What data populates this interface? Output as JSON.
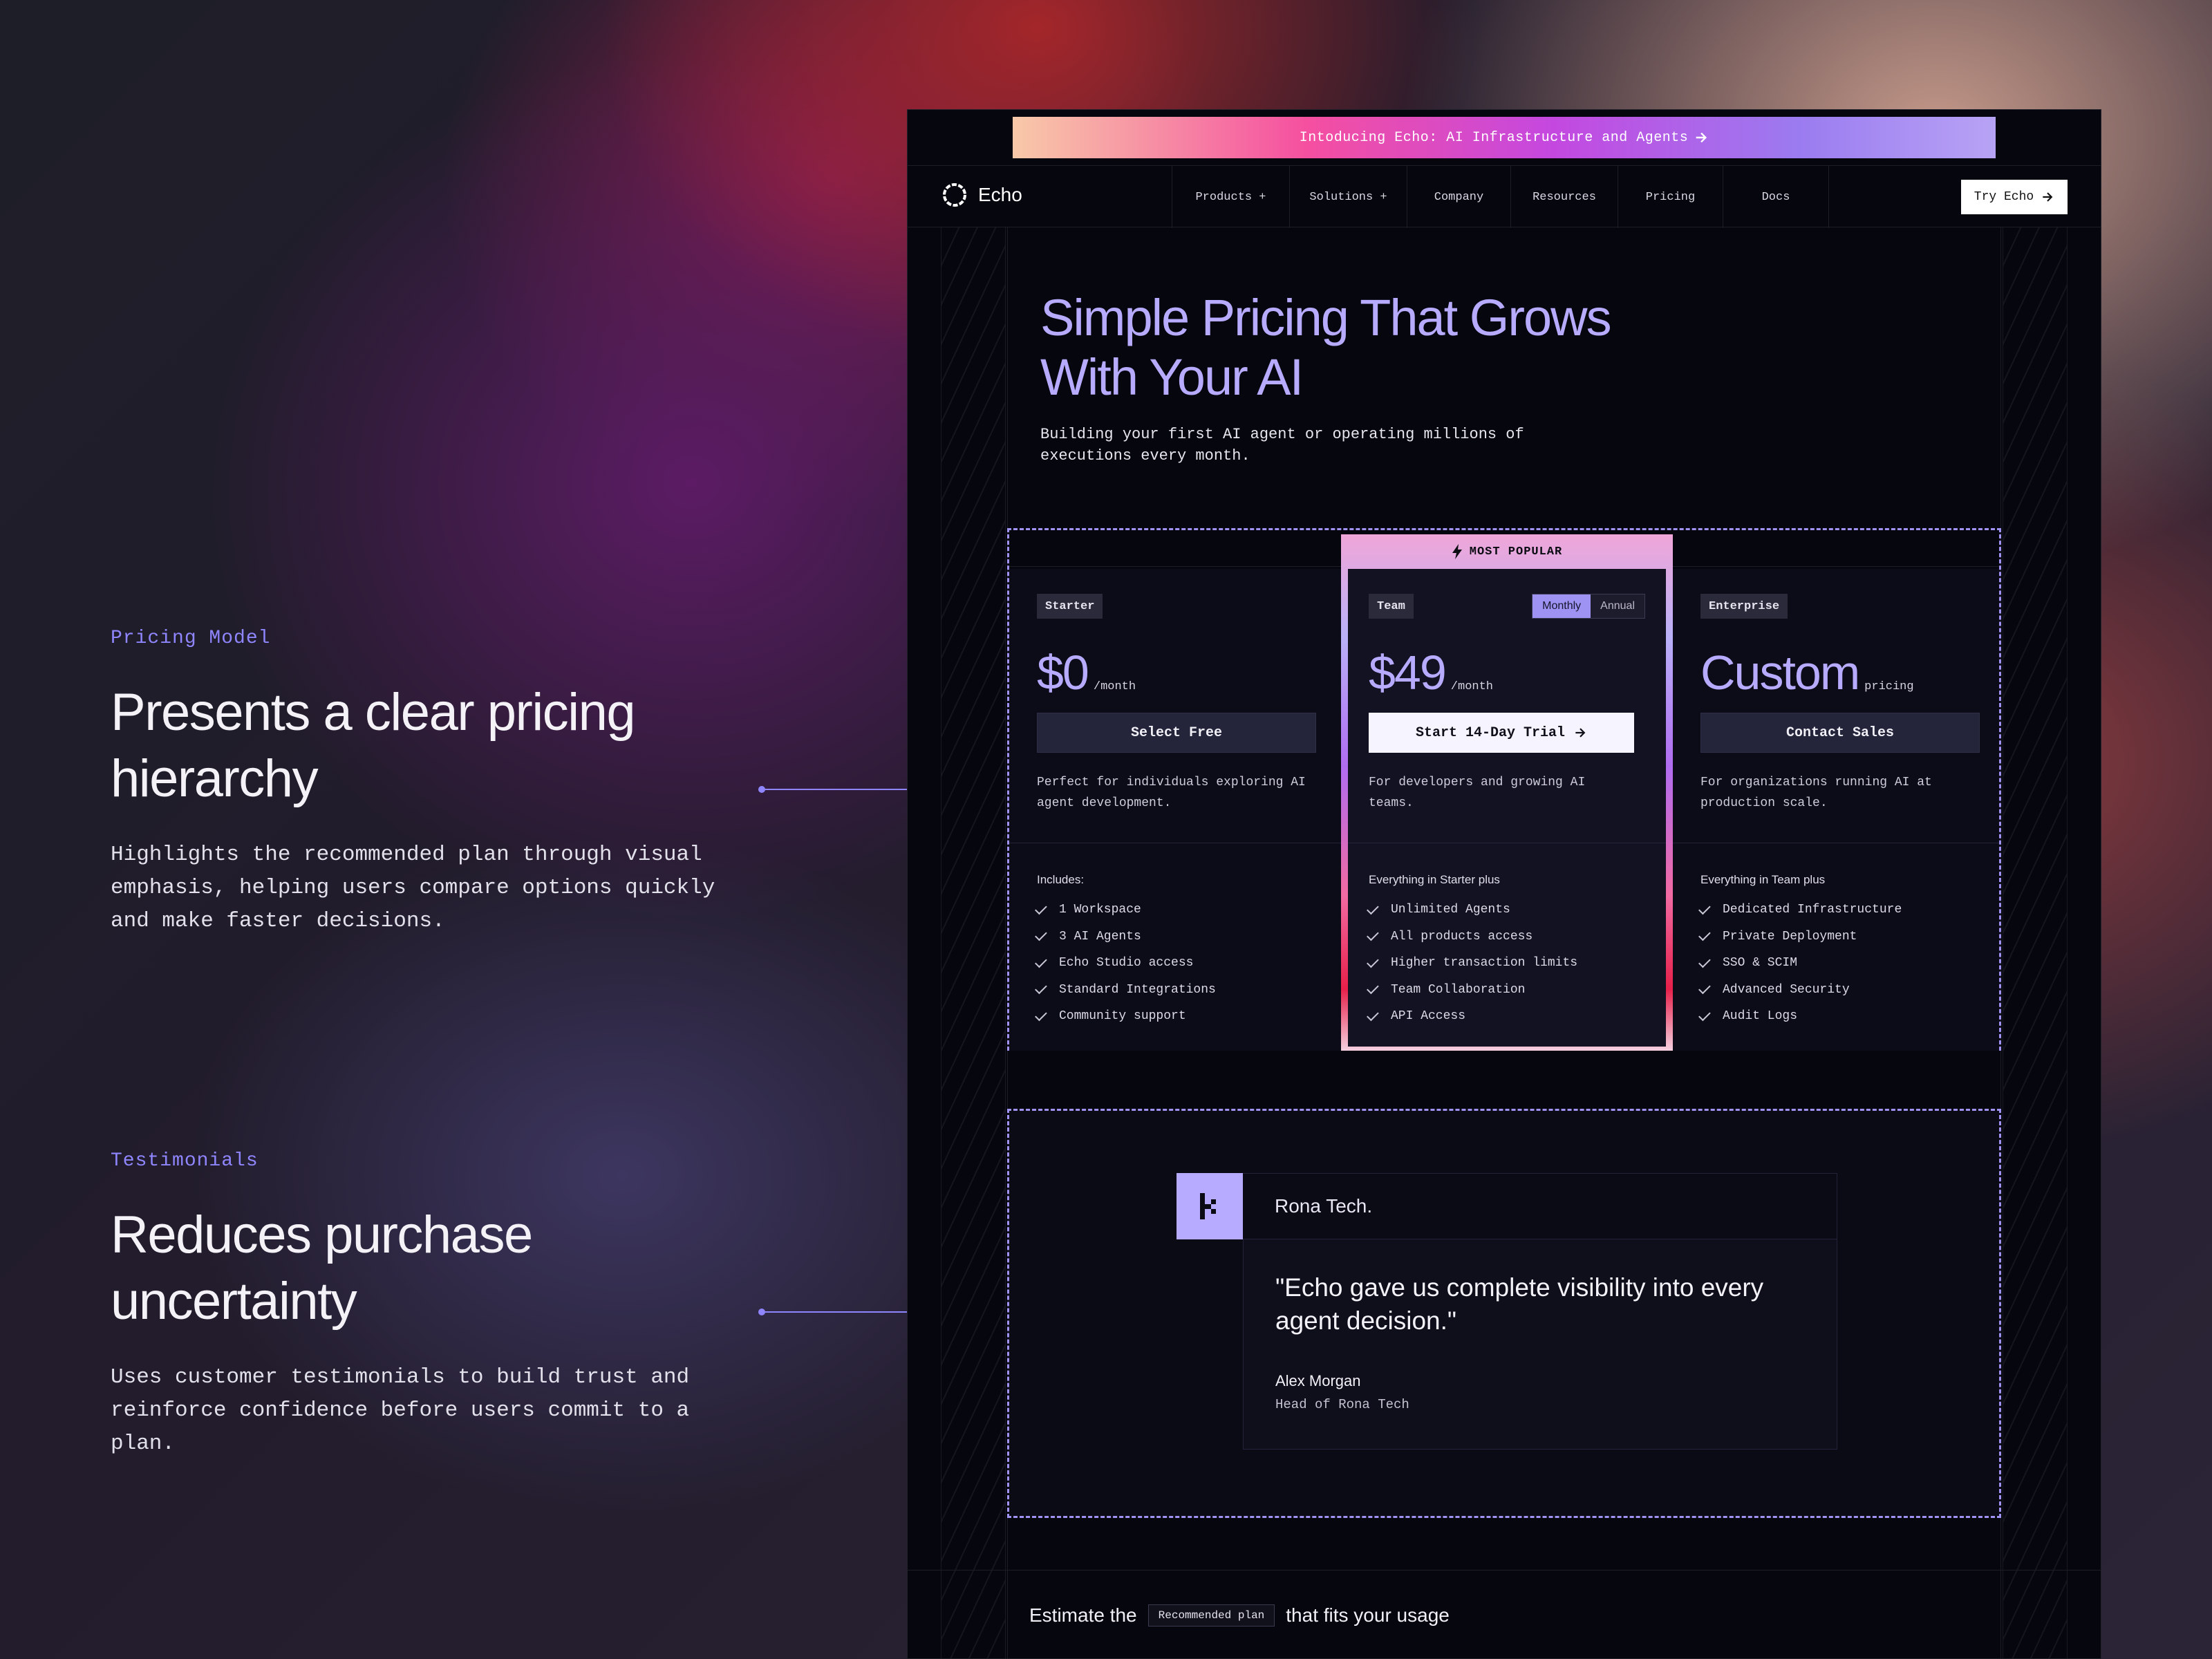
{
  "annotations": [
    {
      "eyebrow": "Pricing Model",
      "title": "Presents a clear pricing hierarchy",
      "body": "Highlights the recommended plan through visual emphasis, helping users compare options quickly and make faster decisions."
    },
    {
      "eyebrow": "Testimonials",
      "title": "Reduces purchase uncertainty",
      "body": "Uses customer testimonials to build trust and reinforce confidence before users commit to a plan."
    }
  ],
  "banner": {
    "text": "Intoducing Echo: AI Infrastructure and Agents",
    "icon": "arrow-right-icon"
  },
  "nav": {
    "brand": "Echo",
    "items": [
      "Products +",
      "Solutions +",
      "Company",
      "Resources",
      "Pricing",
      "Docs"
    ],
    "cta": "Try Echo"
  },
  "hero": {
    "title": "Simple Pricing That Grows\nWith Your AI",
    "subtitle": "Building your first AI agent or operating millions of executions every month."
  },
  "pricing": {
    "popular_label": "MOST POPULAR",
    "billing_toggle": {
      "monthly": "Monthly",
      "annual": "Annual",
      "selected": "Monthly"
    },
    "plans": [
      {
        "tag": "Starter",
        "price": "$0",
        "unit": "/month",
        "cta": "Select Free",
        "description": "Perfect for individuals exploring AI agent development.",
        "includes_title": "Includes:",
        "features": [
          "1 Workspace",
          "3 AI Agents",
          "Echo Studio access",
          "Standard Integrations",
          "Community support"
        ]
      },
      {
        "tag": "Team",
        "price": "$49",
        "unit": "/month",
        "cta": "Start 14-Day Trial",
        "description": "For developers and growing AI teams.",
        "includes_title": "Everything in Starter plus",
        "features": [
          "Unlimited Agents",
          "All products access",
          "Higher transaction limits",
          "Team Collaboration",
          "API Access"
        ]
      },
      {
        "tag": "Enterprise",
        "price": "Custom",
        "unit": "pricing",
        "cta": "Contact Sales",
        "description": "For organizations running AI at production scale.",
        "includes_title": "Everything in Team plus",
        "features": [
          "Dedicated Infrastructure",
          "Private Deployment",
          "SSO & SCIM",
          "Advanced Security",
          "Audit Logs"
        ]
      }
    ]
  },
  "testimonial": {
    "company": "Rona Tech.",
    "quote": "\"Echo gave us complete visibility into every agent decision.\"",
    "author": "Alex Morgan",
    "role": "Head of Rona Tech"
  },
  "estimate": {
    "prefix": "Estimate the",
    "pill": "Recommended plan",
    "suffix": "that fits your usage"
  },
  "colors": {
    "accent": "#b7abff",
    "accent_line": "#8f86ff",
    "page_bg": "#06060e"
  }
}
